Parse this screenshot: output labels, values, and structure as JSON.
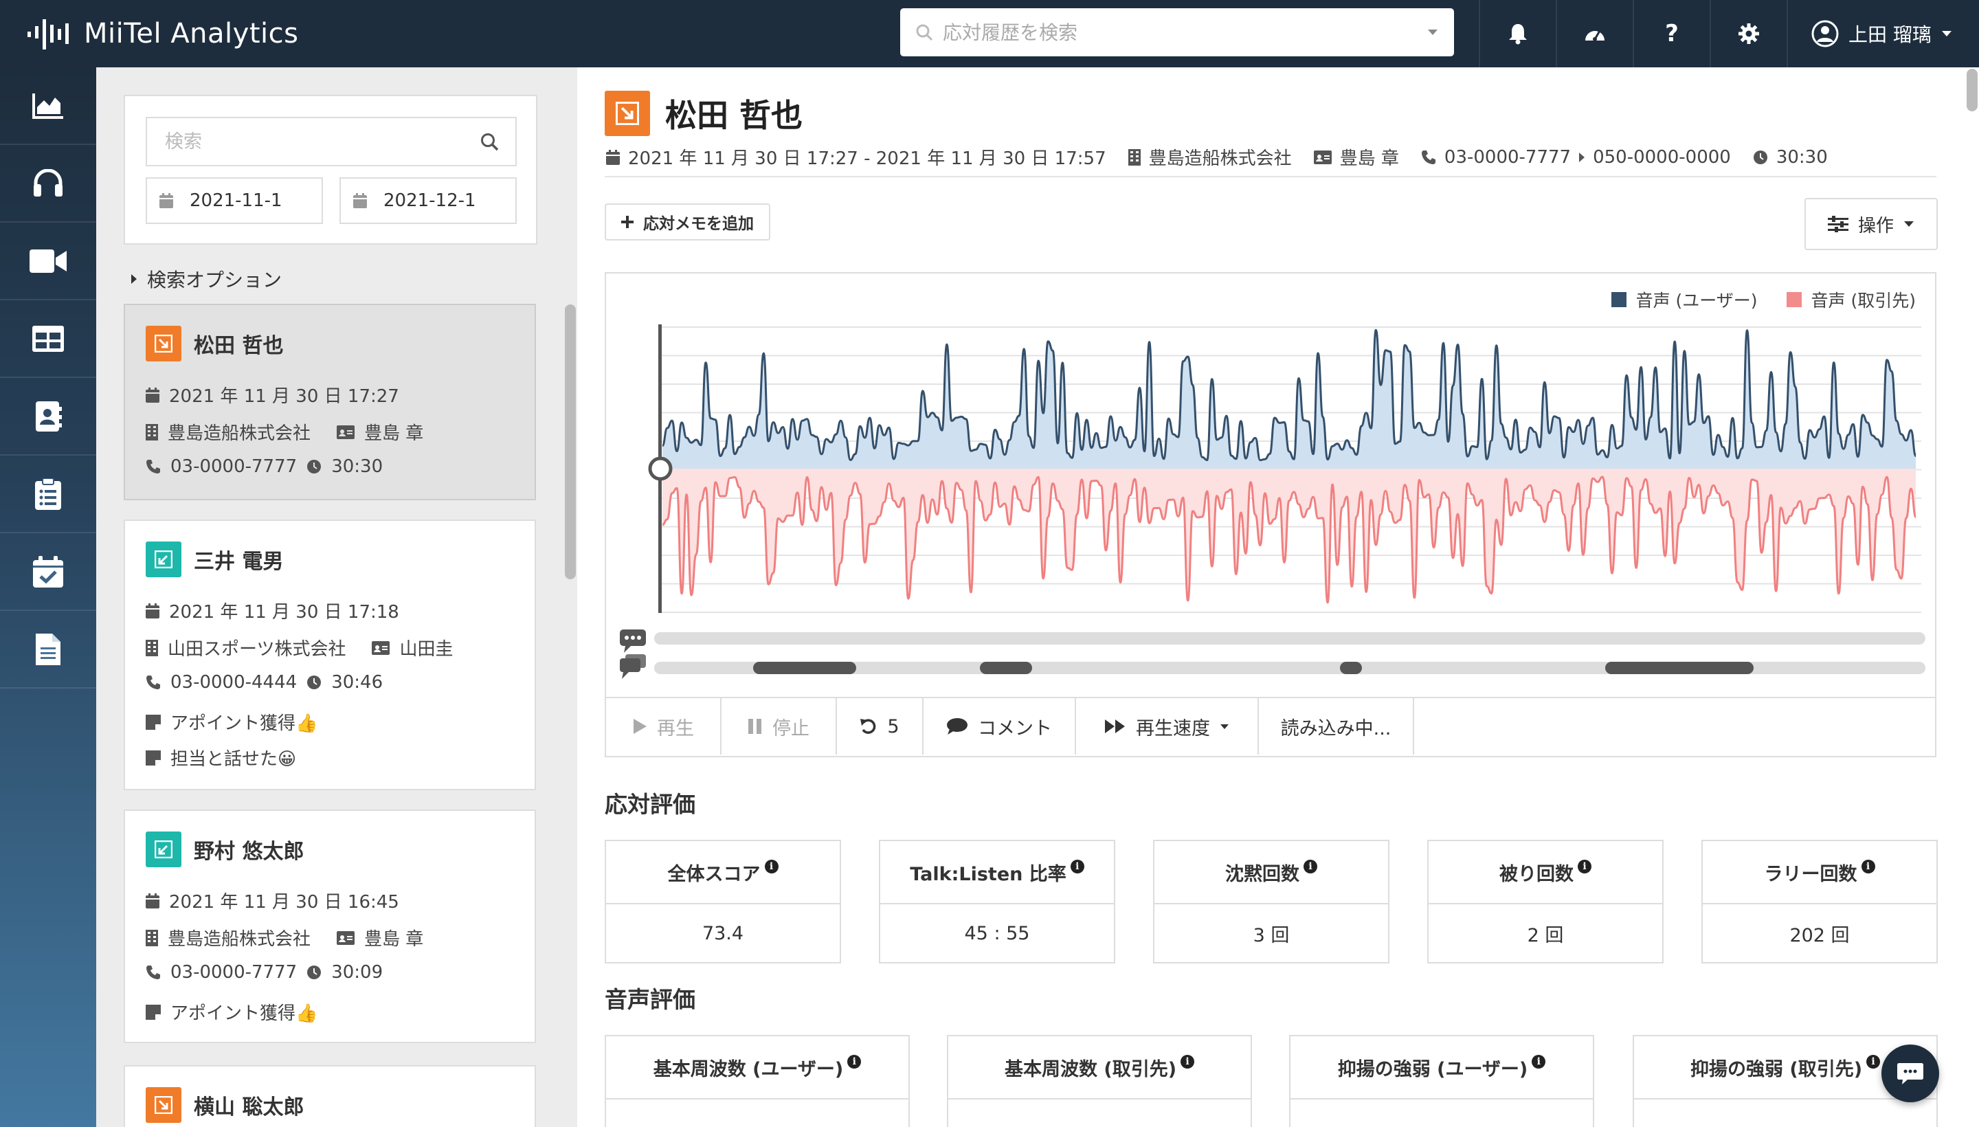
{
  "app": {
    "name": "MiiTel Analytics"
  },
  "topbar": {
    "search_placeholder": "応対履歴を検索",
    "user_name": "上田 瑠璃",
    "icons": [
      "bell-icon",
      "dashboard-icon",
      "help-icon",
      "gear-icon"
    ]
  },
  "sidenav": {
    "items": [
      {
        "name": "analytics",
        "icon": "area-chart-icon"
      },
      {
        "name": "calls",
        "icon": "headset-icon"
      },
      {
        "name": "video",
        "icon": "video-icon"
      },
      {
        "name": "table",
        "icon": "table-icon"
      },
      {
        "name": "contacts",
        "icon": "address-book-icon"
      },
      {
        "name": "tasks",
        "icon": "clipboard-list-icon"
      },
      {
        "name": "calendar",
        "icon": "calendar-check-icon"
      },
      {
        "name": "documents",
        "icon": "document-icon"
      }
    ]
  },
  "list": {
    "search_placeholder": "検索",
    "date_from": "2021-11-1",
    "date_separator": "-",
    "date_to": "2021-12-1",
    "search_options_label": "検索オプション",
    "items": [
      {
        "direction": "outbound",
        "name": "松田 哲也",
        "datetime": "2021 年 11 月 30 日 17:27",
        "company": "豊島造船株式会社",
        "contact": "豊島 章",
        "phone": "03-0000-7777",
        "duration": "30:30",
        "notes": []
      },
      {
        "direction": "inbound",
        "name": "三井 電男",
        "datetime": "2021 年 11 月 30 日 17:18",
        "company": "山田スポーツ株式会社",
        "contact": "山田圭",
        "phone": "03-0000-4444",
        "duration": "30:46",
        "notes": [
          "アポイント獲得👍",
          "担当と話せた😀"
        ]
      },
      {
        "direction": "inbound",
        "name": "野村 悠太郎",
        "datetime": "2021 年 11 月 30 日 16:45",
        "company": "豊島造船株式会社",
        "contact": "豊島 章",
        "phone": "03-0000-7777",
        "duration": "30:09",
        "notes": [
          "アポイント獲得👍"
        ]
      },
      {
        "direction": "outbound",
        "name": "横山 聡太郎"
      }
    ]
  },
  "detail": {
    "name": "松田 哲也",
    "datetime_range": "2021 年 11 月 30 日 17:27 - 2021 年 11 月 30 日 17:57",
    "company": "豊島造船株式会社",
    "contact": "豊島 章",
    "from_phone": "03-0000-7777",
    "to_phone": "050-0000-0000",
    "duration": "30:30",
    "add_memo_label": "応対メモを追加",
    "ops_label": "操作",
    "legend_user": "音声 (ユーザー)",
    "legend_client": "音声 (取引先)",
    "colors": {
      "user": "#34506b",
      "user_fill": "#cfe0f1",
      "client": "#f08080",
      "client_fill": "#fde0e0",
      "accent_out": "#f07c2a",
      "accent_in": "#1db8ab"
    },
    "controls": {
      "play": "再生",
      "stop": "停止",
      "rewind": "5",
      "comment": "コメント",
      "speed": "再生速度",
      "loading": "読み込み中..."
    }
  },
  "response_eval": {
    "title": "応対評価",
    "metrics": [
      {
        "label": "全体スコア",
        "value": "73.4"
      },
      {
        "label": "Talk:Listen 比率",
        "value": "45 : 55"
      },
      {
        "label": "沈黙回数",
        "value": "3 回"
      },
      {
        "label": "被り回数",
        "value": "2 回"
      },
      {
        "label": "ラリー回数",
        "value": "202 回"
      }
    ]
  },
  "voice_eval": {
    "title": "音声評価",
    "metrics": [
      {
        "label": "基本周波数 (ユーザー)"
      },
      {
        "label": "基本周波数 (取引先)"
      },
      {
        "label": "抑揚の強弱 (ユーザー)"
      },
      {
        "label": "抑揚の強弱 (取引先)"
      }
    ]
  }
}
